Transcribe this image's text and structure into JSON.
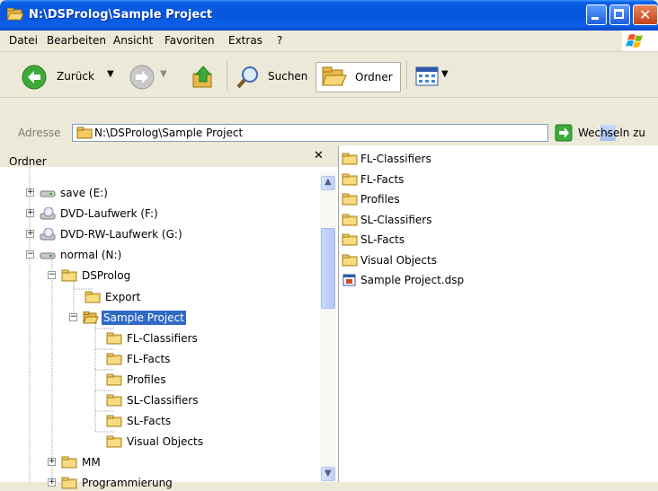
{
  "window": {
    "title": "N:\\DSProlog\\Sample Project"
  },
  "menu": [
    "Datei",
    "Bearbeiten",
    "Ansicht",
    "Favoriten",
    "Extras",
    "?"
  ],
  "toolbar": {
    "back_label": "Zurück",
    "search_label": "Suchen",
    "folders_label": "Ordner"
  },
  "address": {
    "label": "Adresse",
    "value": "N:\\DSProlog\\Sample Project",
    "go_label": "Wechseln zu"
  },
  "folder_pane": {
    "header": "Ordner",
    "close_glyph": "✕",
    "tree": [
      {
        "label": "save (E:)",
        "icon": "drive-icon",
        "expander": "+"
      },
      {
        "label": "DVD-Laufwerk (F:)",
        "icon": "cd-drive-icon",
        "expander": "+"
      },
      {
        "label": "DVD-RW-Laufwerk (G:)",
        "icon": "cd-drive-icon",
        "expander": "+"
      },
      {
        "label": "normal (N:)",
        "icon": "drive-icon",
        "expander": "−"
      },
      {
        "label": "DSProlog",
        "icon": "folder-icon",
        "expander": "−"
      },
      {
        "label": "Export",
        "icon": "folder-icon",
        "expander": ""
      },
      {
        "label": "Sample Project",
        "icon": "folder-open-icon",
        "expander": "−",
        "selected": true
      },
      {
        "label": "FL-Classifiers",
        "icon": "folder-icon",
        "expander": ""
      },
      {
        "label": "FL-Facts",
        "icon": "folder-icon",
        "expander": ""
      },
      {
        "label": "Profiles",
        "icon": "folder-icon",
        "expander": ""
      },
      {
        "label": "SL-Classifiers",
        "icon": "folder-icon",
        "expander": ""
      },
      {
        "label": "SL-Facts",
        "icon": "folder-icon",
        "expander": ""
      },
      {
        "label": "Visual Objects",
        "icon": "folder-icon",
        "expander": ""
      },
      {
        "label": "MM",
        "icon": "folder-icon",
        "expander": "+"
      },
      {
        "label": "Programmierung",
        "icon": "folder-icon",
        "expander": "+"
      }
    ]
  },
  "files": [
    {
      "name": "FL-Classifiers",
      "icon": "folder-icon"
    },
    {
      "name": "FL-Facts",
      "icon": "folder-icon"
    },
    {
      "name": "Profiles",
      "icon": "folder-icon"
    },
    {
      "name": "SL-Classifiers",
      "icon": "folder-icon"
    },
    {
      "name": "SL-Facts",
      "icon": "folder-icon"
    },
    {
      "name": "Visual Objects",
      "icon": "folder-icon"
    },
    {
      "name": "Sample Project.dsp",
      "icon": "dsp-file-icon"
    }
  ]
}
